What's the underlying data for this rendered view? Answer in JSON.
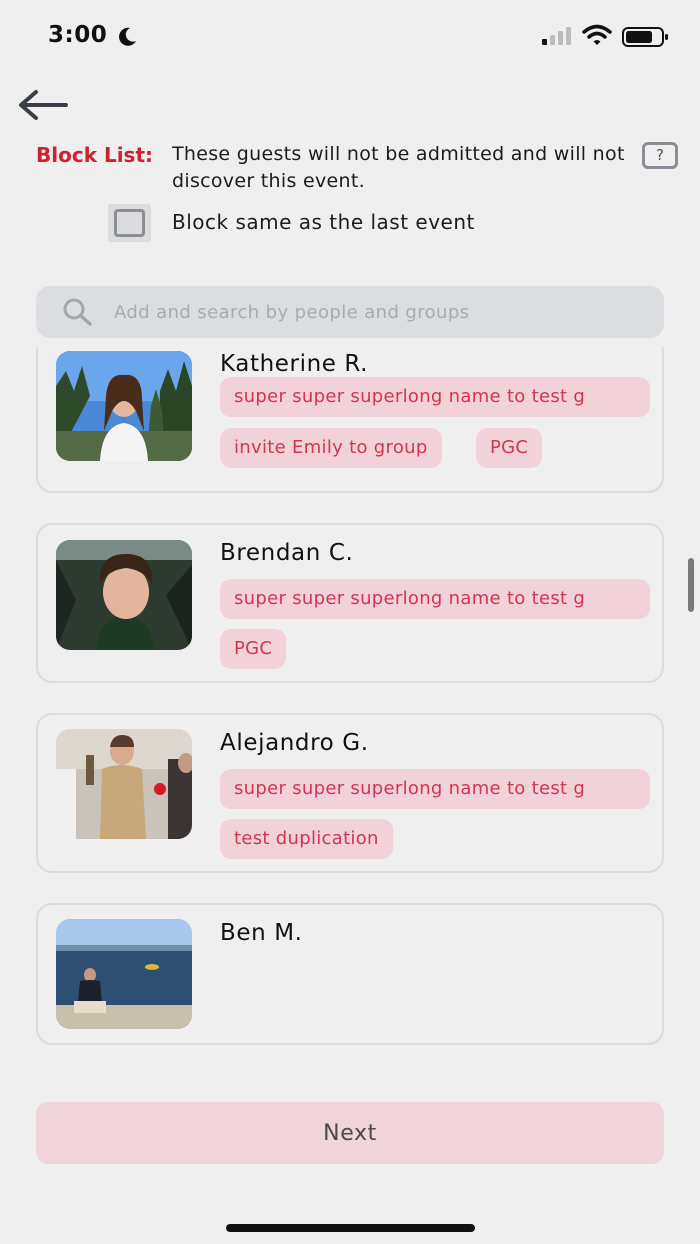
{
  "status_bar": {
    "time": "3:00",
    "icons": [
      "moon-icon",
      "cellular-signal-icon",
      "wifi-icon",
      "battery-icon"
    ]
  },
  "header": {
    "back_icon": "arrow-left-icon",
    "block_label": "Block List:",
    "description": "These guests will not be admitted and will not discover this event.",
    "help_label": "?",
    "same_as_last_label": "Block same as the last event",
    "same_as_last_checked": false
  },
  "search": {
    "icon": "search-icon",
    "placeholder": "Add and search by people and groups",
    "value": ""
  },
  "guests": [
    {
      "name": "Katherine R.",
      "tags": [
        "super super superlong name to test g",
        "invite Emily to group",
        "PGC"
      ]
    },
    {
      "name": "Brendan C.",
      "tags": [
        "super super superlong name to test g",
        "PGC"
      ]
    },
    {
      "name": "Alejandro G.",
      "tags": [
        "super super superlong name to test g",
        "test duplication"
      ]
    },
    {
      "name": "Ben M.",
      "tags": []
    }
  ],
  "footer": {
    "next_label": "Next"
  },
  "colors": {
    "background": "#efefef",
    "accent_red": "#d0222e",
    "tag_bg": "#f2d2d9",
    "tag_text": "#d23451",
    "next_bg": "#efd4da"
  }
}
